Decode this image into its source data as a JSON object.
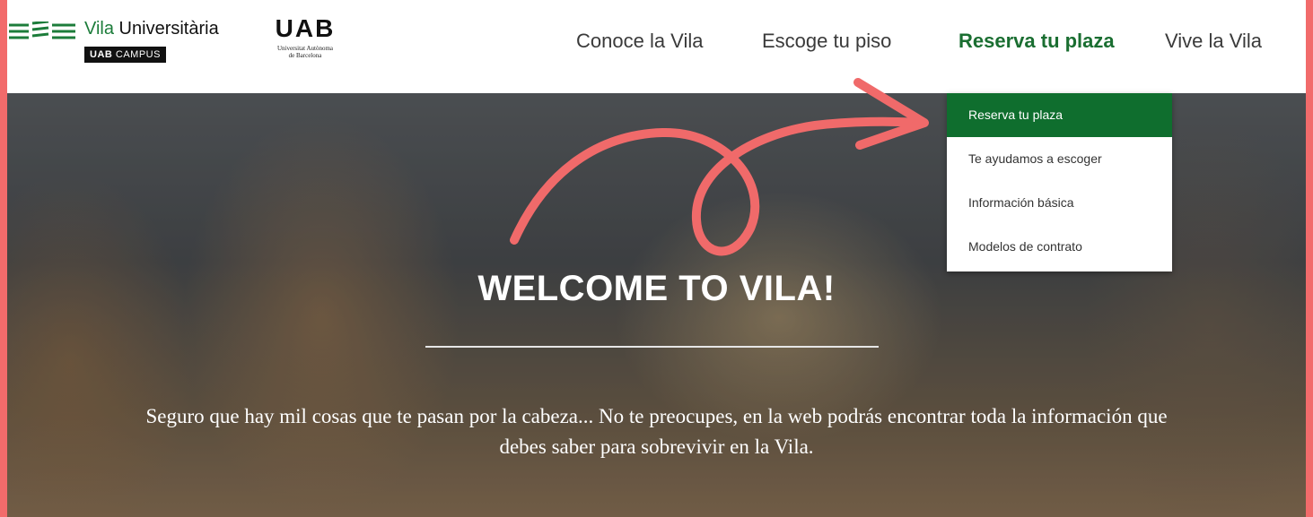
{
  "brand": {
    "vila_prefix": "Vila",
    "vila_suffix": " Universitària",
    "campus_bold": "UAB",
    "campus_text": " CAMPUS",
    "uab_mark": "UAB",
    "uab_sub_line1": "Universitat Autònoma",
    "uab_sub_line2": "de Barcelona"
  },
  "nav": {
    "items": [
      {
        "label": "Conoce la Vila"
      },
      {
        "label": "Escoge tu piso"
      },
      {
        "label": "Reserva tu plaza"
      },
      {
        "label": "Vive la Vila"
      }
    ],
    "active_color": "#1a6e31"
  },
  "dropdown": {
    "items": [
      {
        "label": "Reserva tu plaza"
      },
      {
        "label": "Te ayudamos a escoger"
      },
      {
        "label": "Información básica"
      },
      {
        "label": "Modelos de contrato"
      }
    ],
    "selected_color": "#0f6e2e"
  },
  "hero": {
    "title": "WELCOME TO VILA!",
    "text": "Seguro que hay mil cosas que te pasan por la cabeza... No te preocupes, en la web podrás encontrar toda la información que debes saber para sobrevivir en la Vila."
  },
  "colors": {
    "frame": "#f26b6b",
    "annotation": "#f06a6a",
    "brand_green": "#1c7c3a"
  },
  "icons": {
    "logo_lines": "striped-lines-logo-icon",
    "annotation_arrow": "curved-arrow-icon"
  }
}
